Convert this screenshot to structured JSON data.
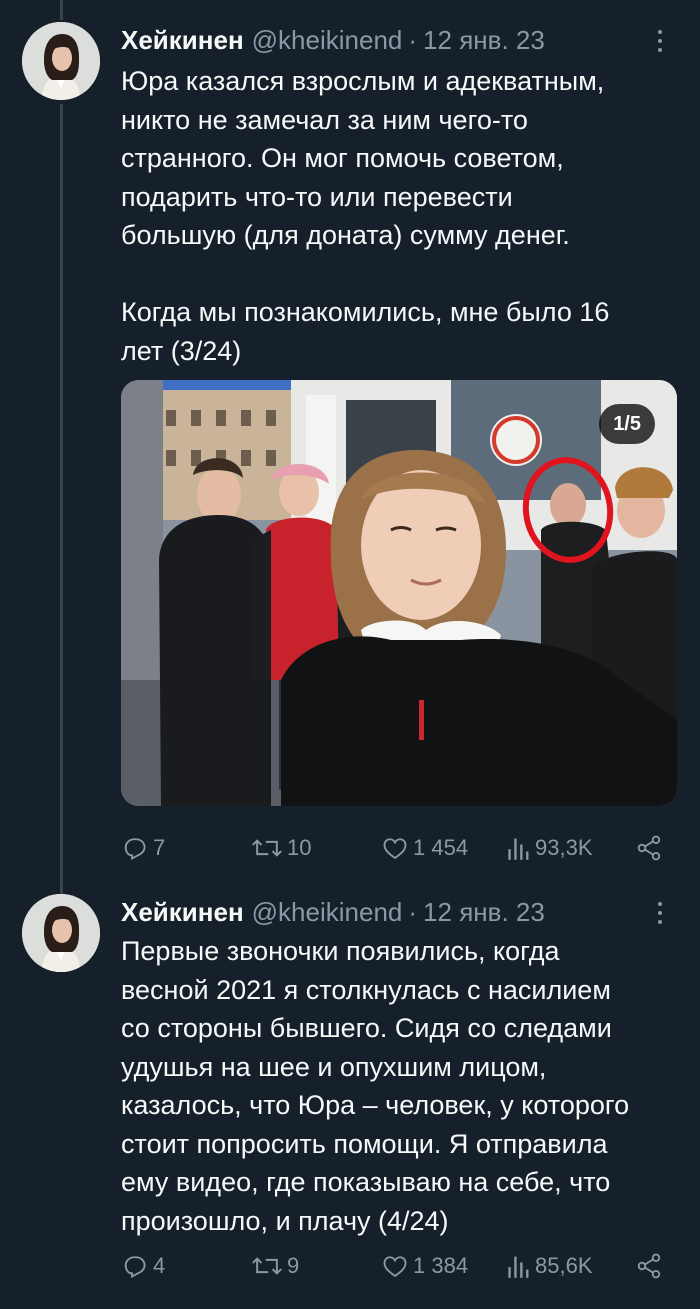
{
  "tweets": [
    {
      "author_name": "Хейкинен",
      "handle": "@kheikinend",
      "separator": "·",
      "date": "12 янв. 23",
      "text_lines": [
        "Юра казался взрослым и адекватным,",
        "никто не замечал за ним чего-то",
        "странного. Он мог помочь советом,",
        "подарить что-то или перевести",
        "большую (для доната) сумму денег.",
        "",
        "Когда мы познакомились, мне было 16",
        "лет (3/24)"
      ],
      "media_counter": "1/5",
      "replies": "7",
      "retweets": "10",
      "likes": "1 454",
      "views": "93,3K"
    },
    {
      "author_name": "Хейкинен",
      "handle": "@kheikinend",
      "separator": "·",
      "date": "12 янв. 23",
      "text_lines": [
        "Первые звоночки появились, когда",
        "весной 2021 я столкнулась с насилием",
        "со стороны бывшего. Сидя со следами",
        "удушья на шее и опухшим лицом,",
        "казалось, что Юра – человек, у которого",
        "стоит попросить помощи. Я отправила",
        "ему видео, где показываю на себе, что",
        "произошло, и плачу (4/24)"
      ],
      "replies": "4",
      "retweets": "9",
      "likes": "1 384",
      "views": "85,6K"
    }
  ],
  "colors": {
    "background": "#15202b",
    "text": "#f7f9f9",
    "secondary": "#8b98a5",
    "thread_line": "#38444d",
    "annotation_circle": "#e0141e"
  },
  "icons": [
    "reply-icon",
    "retweet-icon",
    "like-icon",
    "views-icon",
    "share-icon",
    "more-icon"
  ]
}
